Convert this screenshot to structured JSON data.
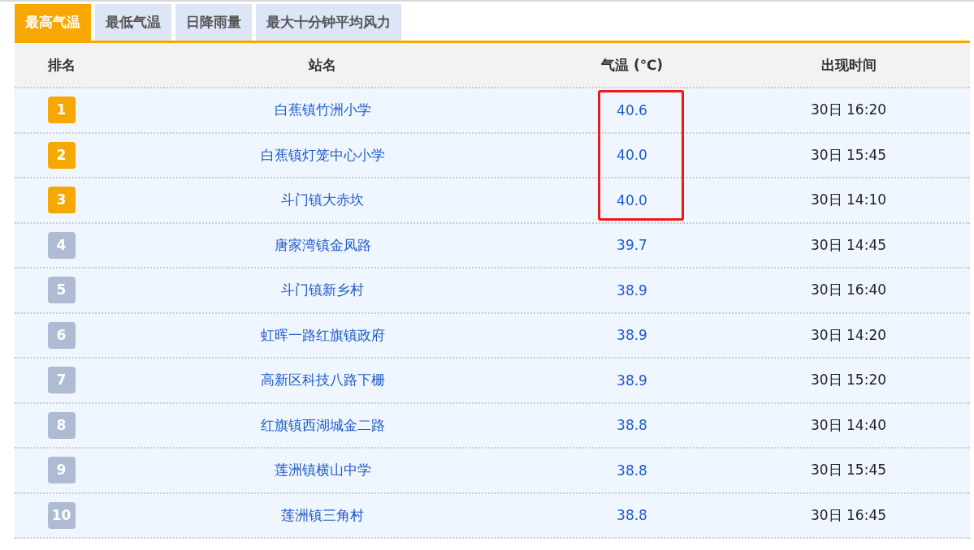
{
  "tabs": [
    {
      "label": "最高气温",
      "selected": true
    },
    {
      "label": "最低气温",
      "selected": false
    },
    {
      "label": "日降雨量",
      "selected": false
    },
    {
      "label": "最大十分钟平均风力",
      "selected": false
    }
  ],
  "table": {
    "columns": [
      "排名",
      "站名",
      "气温 (℃)",
      "出现时间"
    ],
    "rows": [
      {
        "rank": "1",
        "top": true,
        "station": "白蕉镇竹洲小学",
        "temp": "40.6",
        "boxed": true,
        "time": "30日 16:20"
      },
      {
        "rank": "2",
        "top": true,
        "station": "白蕉镇灯笼中心小学",
        "temp": "40.0",
        "boxed": true,
        "time": "30日 15:45"
      },
      {
        "rank": "3",
        "top": true,
        "station": "斗门镇大赤坎",
        "temp": "40.0",
        "boxed": true,
        "time": "30日 14:10"
      },
      {
        "rank": "4",
        "top": false,
        "station": "唐家湾镇金凤路",
        "temp": "39.7",
        "boxed": false,
        "time": "30日 14:45"
      },
      {
        "rank": "5",
        "top": false,
        "station": "斗门镇新乡村",
        "temp": "38.9",
        "boxed": false,
        "time": "30日 16:40"
      },
      {
        "rank": "6",
        "top": false,
        "station": "虹晖一路红旗镇政府",
        "temp": "38.9",
        "boxed": false,
        "time": "30日 14:20"
      },
      {
        "rank": "7",
        "top": false,
        "station": "高新区科技八路下栅",
        "temp": "38.9",
        "boxed": false,
        "time": "30日 15:20"
      },
      {
        "rank": "8",
        "top": false,
        "station": "红旗镇西湖城金二路",
        "temp": "38.8",
        "boxed": false,
        "time": "30日 14:40"
      },
      {
        "rank": "9",
        "top": false,
        "station": "莲洲镇横山中学",
        "temp": "38.8",
        "boxed": false,
        "time": "30日 15:45"
      },
      {
        "rank": "10",
        "top": false,
        "station": "莲洲镇三角村",
        "temp": "38.8",
        "boxed": false,
        "time": "30日 16:45"
      }
    ]
  }
}
